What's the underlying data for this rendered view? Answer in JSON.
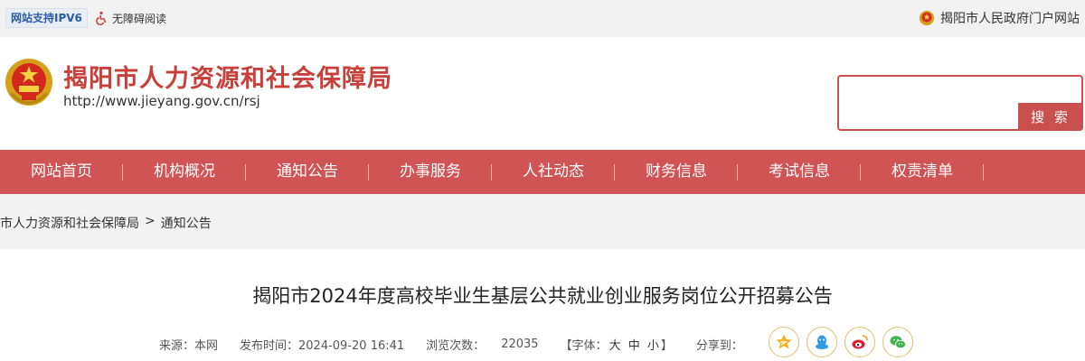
{
  "topbar": {
    "ipv6_label": "网站支持IPV6",
    "accessibility_label": "无障碍阅读",
    "portal_label": "揭阳市人民政府门户网站"
  },
  "header": {
    "site_title": "揭阳市人力资源和社会保障局",
    "site_url": "http://www.jieyang.gov.cn/rsj",
    "search_value": "",
    "search_button": "搜 索"
  },
  "nav": {
    "items": [
      {
        "label": "网站首页"
      },
      {
        "label": "机构概况"
      },
      {
        "label": "通知公告"
      },
      {
        "label": "办事服务"
      },
      {
        "label": "人社动态"
      },
      {
        "label": "财务信息"
      },
      {
        "label": "考试信息"
      },
      {
        "label": "权责清单"
      }
    ]
  },
  "breadcrumb": {
    "root": "市人力资源和社会保障局",
    "separator": ">",
    "current": "通知公告"
  },
  "article": {
    "title": "揭阳市2024年度高校毕业生基层公共就业创业服务岗位公开招募公告",
    "source": "来源：本网",
    "published": "发布时间：2024-09-20 16:41",
    "views_label": "浏览次数：",
    "views": "22035",
    "font_label": "【字体：",
    "font_large": "大",
    "font_medium": "中",
    "font_small": "小",
    "font_close": "】",
    "share_label": "分享到："
  },
  "colors": {
    "brand_red": "#cf5453",
    "title_red": "#c9403a",
    "band_gray": "#f2f2f2"
  },
  "icons": {
    "accessibility": "wheelchair-icon",
    "portal": "national-emblem-icon",
    "share": [
      "qzone-icon",
      "qq-icon",
      "weibo-icon",
      "wechat-icon"
    ]
  }
}
